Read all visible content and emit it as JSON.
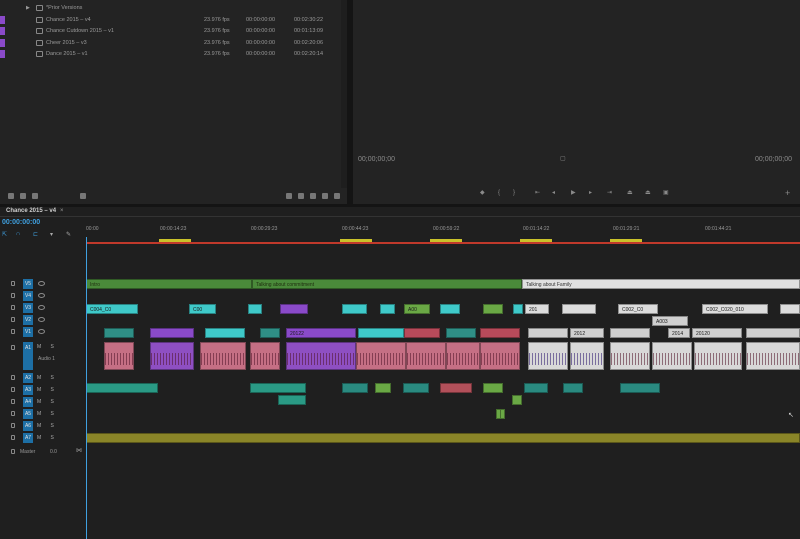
{
  "project": {
    "rows": [
      {
        "type": "bin",
        "name": "*Prior Versions",
        "fps": "",
        "in": "",
        "dur": "",
        "color": ""
      },
      {
        "type": "seq",
        "name": "Chance 2015 – v4",
        "fps": "23.976 fps",
        "in": "00:00:00:00",
        "dur": "00:02:30:22",
        "color": "#8a4ac9"
      },
      {
        "type": "seq",
        "name": "Chance Cutdown 2015 – v1",
        "fps": "23.976 fps",
        "in": "00:00:00:00",
        "dur": "00:01:13:09",
        "color": "#8a4ac9"
      },
      {
        "type": "seq",
        "name": "Cheer 2015 – v3",
        "fps": "23.976 fps",
        "in": "00:00:00:00",
        "dur": "00:02:20:06",
        "color": "#8a4ac9"
      },
      {
        "type": "seq",
        "name": "Dance 2015 – v1",
        "fps": "23.976 fps",
        "in": "00:00:00:00",
        "dur": "00:02:20:14",
        "color": "#8a4ac9"
      }
    ]
  },
  "program": {
    "tc_left": "00;00;00;00",
    "tc_right": "00;00;00;00"
  },
  "timeline": {
    "tab": "Chance 2015 – v4",
    "timecode": "00:00:00:00",
    "ruler": [
      {
        "label": "00:00",
        "pos": 0
      },
      {
        "label": "00:00:14:23",
        "pos": 74
      },
      {
        "label": "00:00:29:23",
        "pos": 165
      },
      {
        "label": "00:00:44:23",
        "pos": 256
      },
      {
        "label": "00:00:59:22",
        "pos": 347
      },
      {
        "label": "00:01:14:22",
        "pos": 437
      },
      {
        "label": "00:01:29:21",
        "pos": 527
      },
      {
        "label": "00:01:44:21",
        "pos": 619
      }
    ],
    "tracks": {
      "v5": "V5",
      "v4": "V4",
      "v3": "V3",
      "v2": "V2",
      "v1": "V1",
      "a1": "A1",
      "audio1": "Audio 1",
      "a2": "A2",
      "a3": "A3",
      "a4": "A4",
      "a5": "A5",
      "a6": "A6",
      "a7": "A7",
      "master": "Master",
      "master_val": "0.0"
    },
    "clip_labels": {
      "v3a": "Intro",
      "v3b": "Talking about commitment",
      "v3c": "Talking about Family",
      "c004": "C004_C0",
      "c00": "C00",
      "a00": "A00",
      "c002": "C002_C0",
      "c002b": "C002_C020_010",
      "a003": "A003",
      "d2014": "2014",
      "d20120": "20120",
      "d2012": "2012",
      "d201": "201",
      "d20122": "20122"
    }
  }
}
